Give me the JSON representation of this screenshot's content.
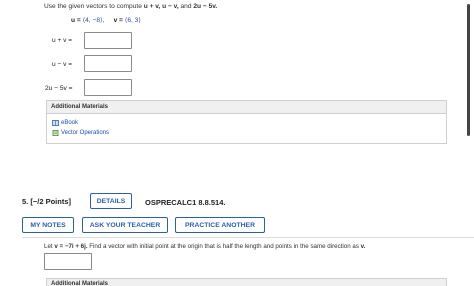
{
  "q1": {
    "intro_prefix": "Use the given vectors to compute",
    "intro_ops": [
      "u + v,",
      "u − v,"
    ],
    "intro_and": "and",
    "intro_last": "2u − 5v.",
    "u_label": "u =",
    "u_value": "⟨4, −8⟩,",
    "v_label": "v =",
    "v_value": "⟨6, 3⟩",
    "rows": [
      {
        "label": "u + v =",
        "value": ""
      },
      {
        "label": "u − v =",
        "value": ""
      },
      {
        "label": "2u − 5v =",
        "value": ""
      }
    ],
    "materials": {
      "title": "Additional Materials",
      "links": [
        "eBook",
        "Vector Operations"
      ]
    }
  },
  "q2": {
    "number": "5.",
    "points": "[−/2 Points]",
    "details_button": "DETAILS",
    "code": "OSPRECALC1 8.8.514.",
    "buttons": [
      "MY NOTES",
      "ASK YOUR TEACHER",
      "PRACTICE ANOTHER"
    ],
    "text_prefix": "Let",
    "text_vector": "v = −7i + 6j.",
    "text_rest": "Find a vector with initial point at the origin that is half the length and points in the same direction as",
    "text_end": "v.",
    "answer_value": "",
    "materials_title": "Additional Materials"
  },
  "colors": {
    "accent": "#2b5fa8",
    "value_blue": "#2a4fa0"
  }
}
